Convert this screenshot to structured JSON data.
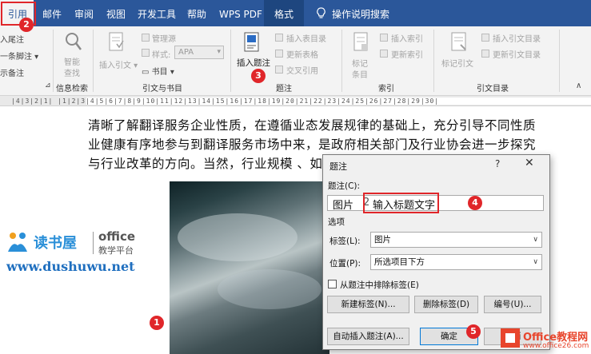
{
  "tabs": [
    {
      "label": "引用",
      "active": true
    },
    {
      "label": "邮件"
    },
    {
      "label": "审阅"
    },
    {
      "label": "视图"
    },
    {
      "label": "开发工具"
    },
    {
      "label": "帮助"
    },
    {
      "label": "WPS PDF"
    },
    {
      "label": "格式"
    }
  ],
  "tell_me": "操作说明搜索",
  "ribbon": {
    "footnotes": {
      "insert_endnote": "入尾注",
      "next_footnote": "一条脚注",
      "show_notes": "示备注"
    },
    "info_retrieval": {
      "smart_lookup": [
        "智能",
        "查找"
      ],
      "group_label": "信息检索"
    },
    "citations": {
      "insert_citation": "插入引文",
      "manage_sources": "管理源",
      "style_label": "样式:",
      "style_value": "APA",
      "bibliography": "书目",
      "group_label": "引文与书目"
    },
    "captions": {
      "insert_caption": "插入题注",
      "insert_table_of_figures": "插入表目录",
      "update_table": "更新表格",
      "cross_reference": "交叉引用",
      "group_label": "题注"
    },
    "index": {
      "mark_entry": [
        "标记",
        "条目"
      ],
      "insert_index": "插入索引",
      "update_index": "更新索引",
      "group_label": "索引"
    },
    "toa": {
      "mark_citation": "标记引文",
      "insert_toa": "插入引文目录",
      "update_toa": "更新引文目录",
      "group_label": "引文目录"
    }
  },
  "ruler_text": "|4|3|2|1| |1|2|3|4|5|6|7|8|9|10|11|12|13|14|15|16|17|18|19|20|21|22|23|24|25|26|27|28|29|30|",
  "document": {
    "lines": [
      "清晰了解翻译服务企业性质，在遵循业态发展规律的基础上，充分引导不同性质",
      "业健康有序地参与到翻译服务市场中来，是政府相关部门及行业协会进一步探究",
      "与行业改革的方向。当然，行业规模        、如何使"
    ]
  },
  "watermark": {
    "brand": "读书屋",
    "office": "office",
    "sub": "教学平台",
    "url": "www.dushuwu.net",
    "site2_title": "Office教程网",
    "site2_url": "www.office26.com"
  },
  "dialog": {
    "title": "题注",
    "help": "?",
    "close": "✕",
    "caption_label": "题注(C):",
    "caption_prefix": "图片",
    "caption_number": "2",
    "caption_text": "输入标题文字",
    "options_label": "选项",
    "label_label": "标签(L):",
    "label_value": "图片",
    "position_label": "位置(P):",
    "position_value": "所选项目下方",
    "exclude_label_text": "从题注中排除标签(E)",
    "new_label_button": "新建标签(N)...",
    "delete_label_button": "删除标签(D)",
    "numbering_button": "编号(U)...",
    "autocaption_button": "自动插入题注(A)...",
    "ok_button": "确定",
    "cancel_button": "取消"
  },
  "markers": [
    "1",
    "2",
    "3",
    "4",
    "5"
  ],
  "colors": {
    "ribbon_blue": "#2b579a",
    "marker_red": "#e0262a"
  }
}
